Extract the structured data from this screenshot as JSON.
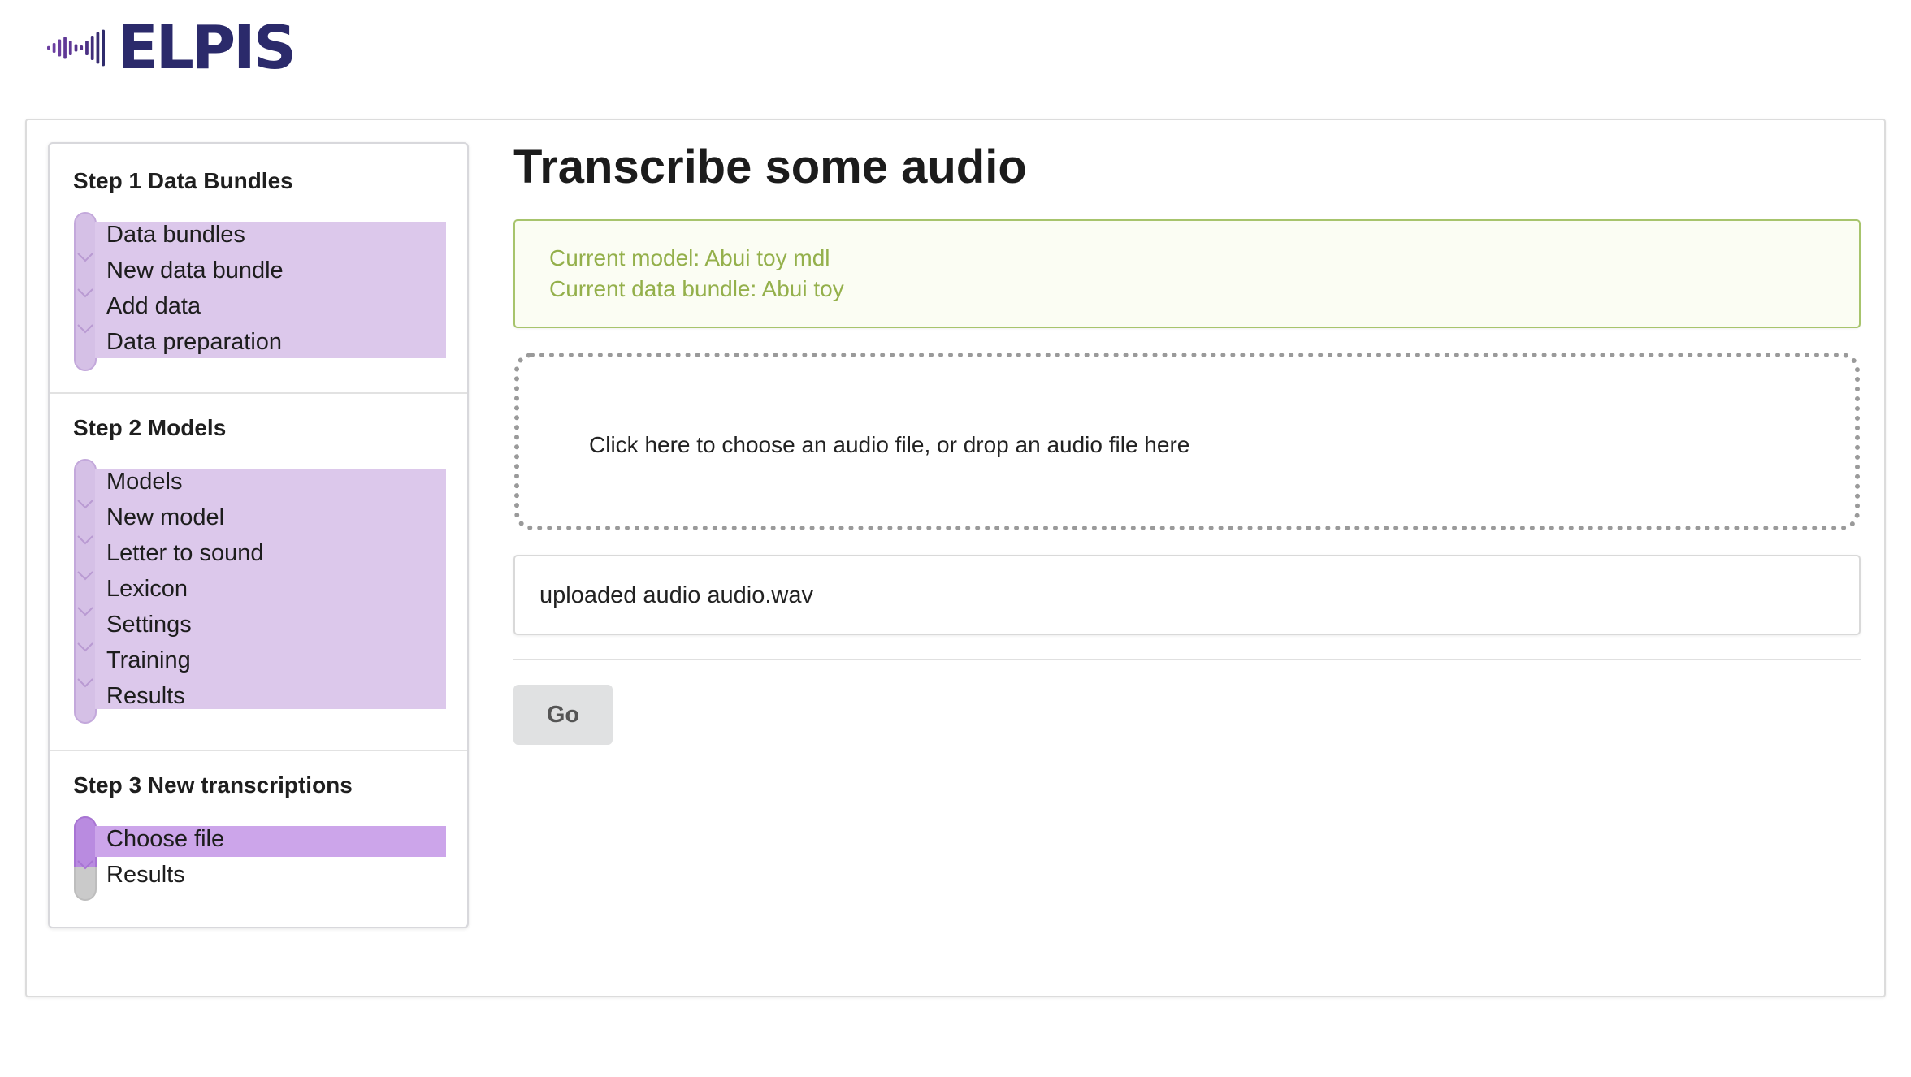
{
  "app": {
    "logo_text": "ELPIS",
    "colors": {
      "logo_dark": "#2b2a6b",
      "logo_purple": "#6b3fa0"
    }
  },
  "sidebar": {
    "steps": [
      {
        "title": "Step 1 Data Bundles",
        "items": [
          {
            "label": "Data bundles"
          },
          {
            "label": "New data bundle"
          },
          {
            "label": "Add data"
          },
          {
            "label": "Data preparation"
          }
        ]
      },
      {
        "title": "Step 2 Models",
        "items": [
          {
            "label": "Models"
          },
          {
            "label": "New model"
          },
          {
            "label": "Letter to sound"
          },
          {
            "label": "Lexicon"
          },
          {
            "label": "Settings"
          },
          {
            "label": "Training"
          },
          {
            "label": "Results"
          }
        ]
      },
      {
        "title": "Step 3 New transcriptions",
        "items": [
          {
            "label": "Choose file",
            "state": "active"
          },
          {
            "label": "Results",
            "state": "disabled"
          }
        ]
      }
    ],
    "colors": {
      "completed": "#dcc8eb",
      "active": "#cca5ea",
      "disabled": "#cacaca"
    }
  },
  "main": {
    "title": "Transcribe some audio",
    "info": {
      "model_line": "Current model: Abui toy mdl",
      "bundle_line": "Current data bundle: Abui toy",
      "color": "#94b04b"
    },
    "dropzone": {
      "text": "Click here to choose an audio file, or drop an audio file here"
    },
    "uploaded": {
      "text": "uploaded audio audio.wav"
    },
    "go_button": {
      "label": "Go"
    }
  }
}
